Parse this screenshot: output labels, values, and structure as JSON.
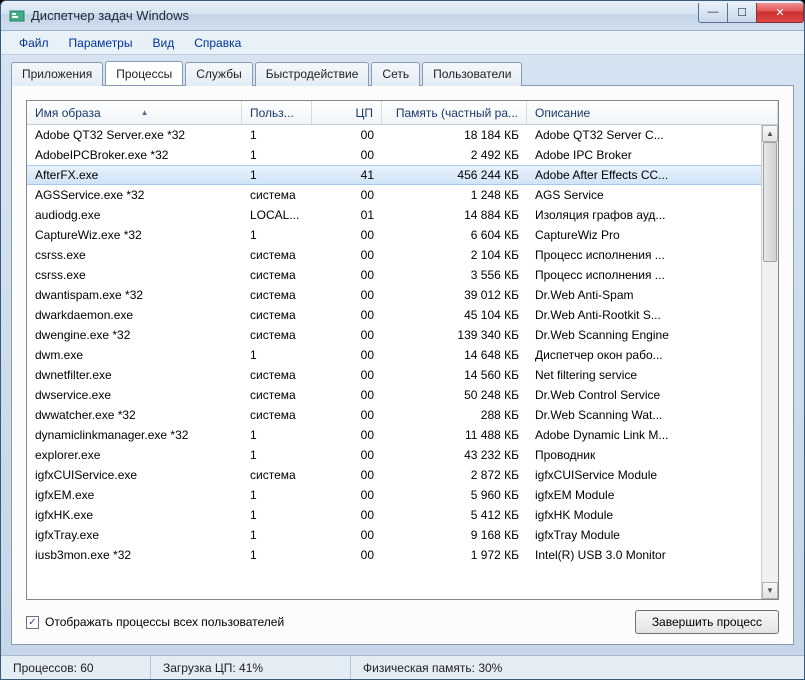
{
  "window": {
    "title": "Диспетчер задач Windows"
  },
  "menu": {
    "file": "Файл",
    "options": "Параметры",
    "view": "Вид",
    "help": "Справка"
  },
  "tabs": {
    "apps": "Приложения",
    "processes": "Процессы",
    "services": "Службы",
    "performance": "Быстродействие",
    "network": "Сеть",
    "users": "Пользователи"
  },
  "columns": {
    "image": "Имя образа",
    "user": "Польз...",
    "cpu": "ЦП",
    "memory": "Память (частный ра...",
    "description": "Описание"
  },
  "rows": [
    {
      "name": "Adobe QT32 Server.exe *32",
      "user": "1",
      "cpu": "00",
      "mem": "18 184 КБ",
      "desc": "Adobe QT32 Server C...",
      "sel": false
    },
    {
      "name": "AdobeIPCBroker.exe *32",
      "user": "1",
      "cpu": "00",
      "mem": "2 492 КБ",
      "desc": "Adobe IPC Broker",
      "sel": false
    },
    {
      "name": "AfterFX.exe",
      "user": "1",
      "cpu": "41",
      "mem": "456 244 КБ",
      "desc": "Adobe After Effects CC...",
      "sel": true
    },
    {
      "name": "AGSService.exe *32",
      "user": "система",
      "cpu": "00",
      "mem": "1 248 КБ",
      "desc": "AGS Service",
      "sel": false
    },
    {
      "name": "audiodg.exe",
      "user": "LOCAL...",
      "cpu": "01",
      "mem": "14 884 КБ",
      "desc": "Изоляция графов ауд...",
      "sel": false
    },
    {
      "name": "CaptureWiz.exe *32",
      "user": "1",
      "cpu": "00",
      "mem": "6 604 КБ",
      "desc": "CaptureWiz Pro",
      "sel": false
    },
    {
      "name": "csrss.exe",
      "user": "система",
      "cpu": "00",
      "mem": "2 104 КБ",
      "desc": "Процесс исполнения ...",
      "sel": false
    },
    {
      "name": "csrss.exe",
      "user": "система",
      "cpu": "00",
      "mem": "3 556 КБ",
      "desc": "Процесс исполнения ...",
      "sel": false
    },
    {
      "name": "dwantispam.exe *32",
      "user": "система",
      "cpu": "00",
      "mem": "39 012 КБ",
      "desc": "Dr.Web Anti-Spam",
      "sel": false
    },
    {
      "name": "dwarkdaemon.exe",
      "user": "система",
      "cpu": "00",
      "mem": "45 104 КБ",
      "desc": "Dr.Web Anti-Rootkit S...",
      "sel": false
    },
    {
      "name": "dwengine.exe *32",
      "user": "система",
      "cpu": "00",
      "mem": "139 340 КБ",
      "desc": "Dr.Web Scanning Engine",
      "sel": false
    },
    {
      "name": "dwm.exe",
      "user": "1",
      "cpu": "00",
      "mem": "14 648 КБ",
      "desc": "Диспетчер окон рабо...",
      "sel": false
    },
    {
      "name": "dwnetfilter.exe",
      "user": "система",
      "cpu": "00",
      "mem": "14 560 КБ",
      "desc": "Net filtering service",
      "sel": false
    },
    {
      "name": "dwservice.exe",
      "user": "система",
      "cpu": "00",
      "mem": "50 248 КБ",
      "desc": "Dr.Web Control Service",
      "sel": false
    },
    {
      "name": "dwwatcher.exe *32",
      "user": "система",
      "cpu": "00",
      "mem": "288 КБ",
      "desc": "Dr.Web Scanning Wat...",
      "sel": false
    },
    {
      "name": "dynamiclinkmanager.exe *32",
      "user": "1",
      "cpu": "00",
      "mem": "11 488 КБ",
      "desc": "Adobe Dynamic Link M...",
      "sel": false
    },
    {
      "name": "explorer.exe",
      "user": "1",
      "cpu": "00",
      "mem": "43 232 КБ",
      "desc": "Проводник",
      "sel": false
    },
    {
      "name": "igfxCUIService.exe",
      "user": "система",
      "cpu": "00",
      "mem": "2 872 КБ",
      "desc": "igfxCUIService Module",
      "sel": false
    },
    {
      "name": "igfxEM.exe",
      "user": "1",
      "cpu": "00",
      "mem": "5 960 КБ",
      "desc": "igfxEM Module",
      "sel": false
    },
    {
      "name": "igfxHK.exe",
      "user": "1",
      "cpu": "00",
      "mem": "5 412 КБ",
      "desc": "igfxHK Module",
      "sel": false
    },
    {
      "name": "igfxTray.exe",
      "user": "1",
      "cpu": "00",
      "mem": "9 168 КБ",
      "desc": "igfxTray Module",
      "sel": false
    },
    {
      "name": "iusb3mon.exe *32",
      "user": "1",
      "cpu": "00",
      "mem": "1 972 КБ",
      "desc": "Intel(R) USB 3.0 Monitor",
      "sel": false
    }
  ],
  "checkbox": {
    "label": "Отображать процессы всех пользователей",
    "checked": true
  },
  "buttons": {
    "end_process": "Завершить процесс"
  },
  "status": {
    "processes": "Процессов: 60",
    "cpu": "Загрузка ЦП: 41%",
    "memory": "Физическая память: 30%"
  }
}
